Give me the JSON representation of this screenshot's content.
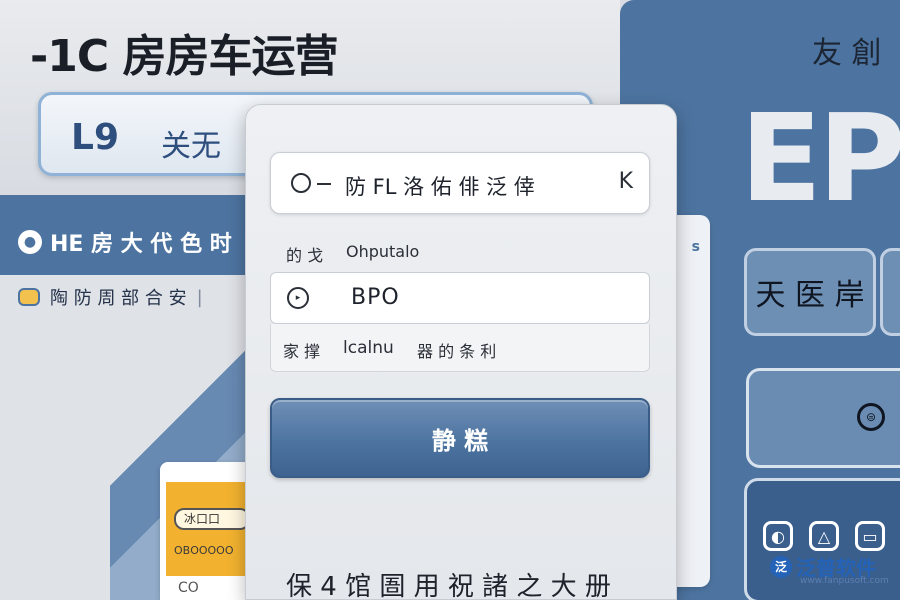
{
  "header": {
    "title": "-1C 房房车运营"
  },
  "top_search": {
    "logo": "L9",
    "text": "关无"
  },
  "sidebar": {
    "band_item": {
      "icon": "user-icon",
      "label": "HE 房 大 代 色 时"
    },
    "menu_item": {
      "icon": "folder-icon",
      "label": "陶 防 周 部 合 安",
      "separator": "|"
    }
  },
  "small_card": {
    "label1": "冰口口",
    "label2": "ОВООООО",
    "label3": "CO"
  },
  "modal": {
    "search_field": {
      "text": "防 FL 洛 佑 俳 泛 倖",
      "right_icon": "K"
    },
    "row": {
      "label": "的 戈",
      "value": "Ohputalo"
    },
    "input_field": {
      "text": "BPO"
    },
    "sub_row": {
      "a": "家 撑",
      "b": "lcalnu",
      "c": "器 的 条 利"
    },
    "primary_button": "静 糕",
    "footer": "保 4 馆 圄 用 祝 諸 之 大 册"
  },
  "right_panel": {
    "top_text": "友 創",
    "big_text": "EP",
    "button_label": "天 医 岸",
    "card_icon": "⊜",
    "bottom_icons": [
      "◐",
      "△",
      "▭"
    ]
  },
  "back_card": {
    "hint": "s"
  },
  "watermark": {
    "text": "泛普软件",
    "mark": "泛",
    "url": "www.fanpusoft.com"
  }
}
